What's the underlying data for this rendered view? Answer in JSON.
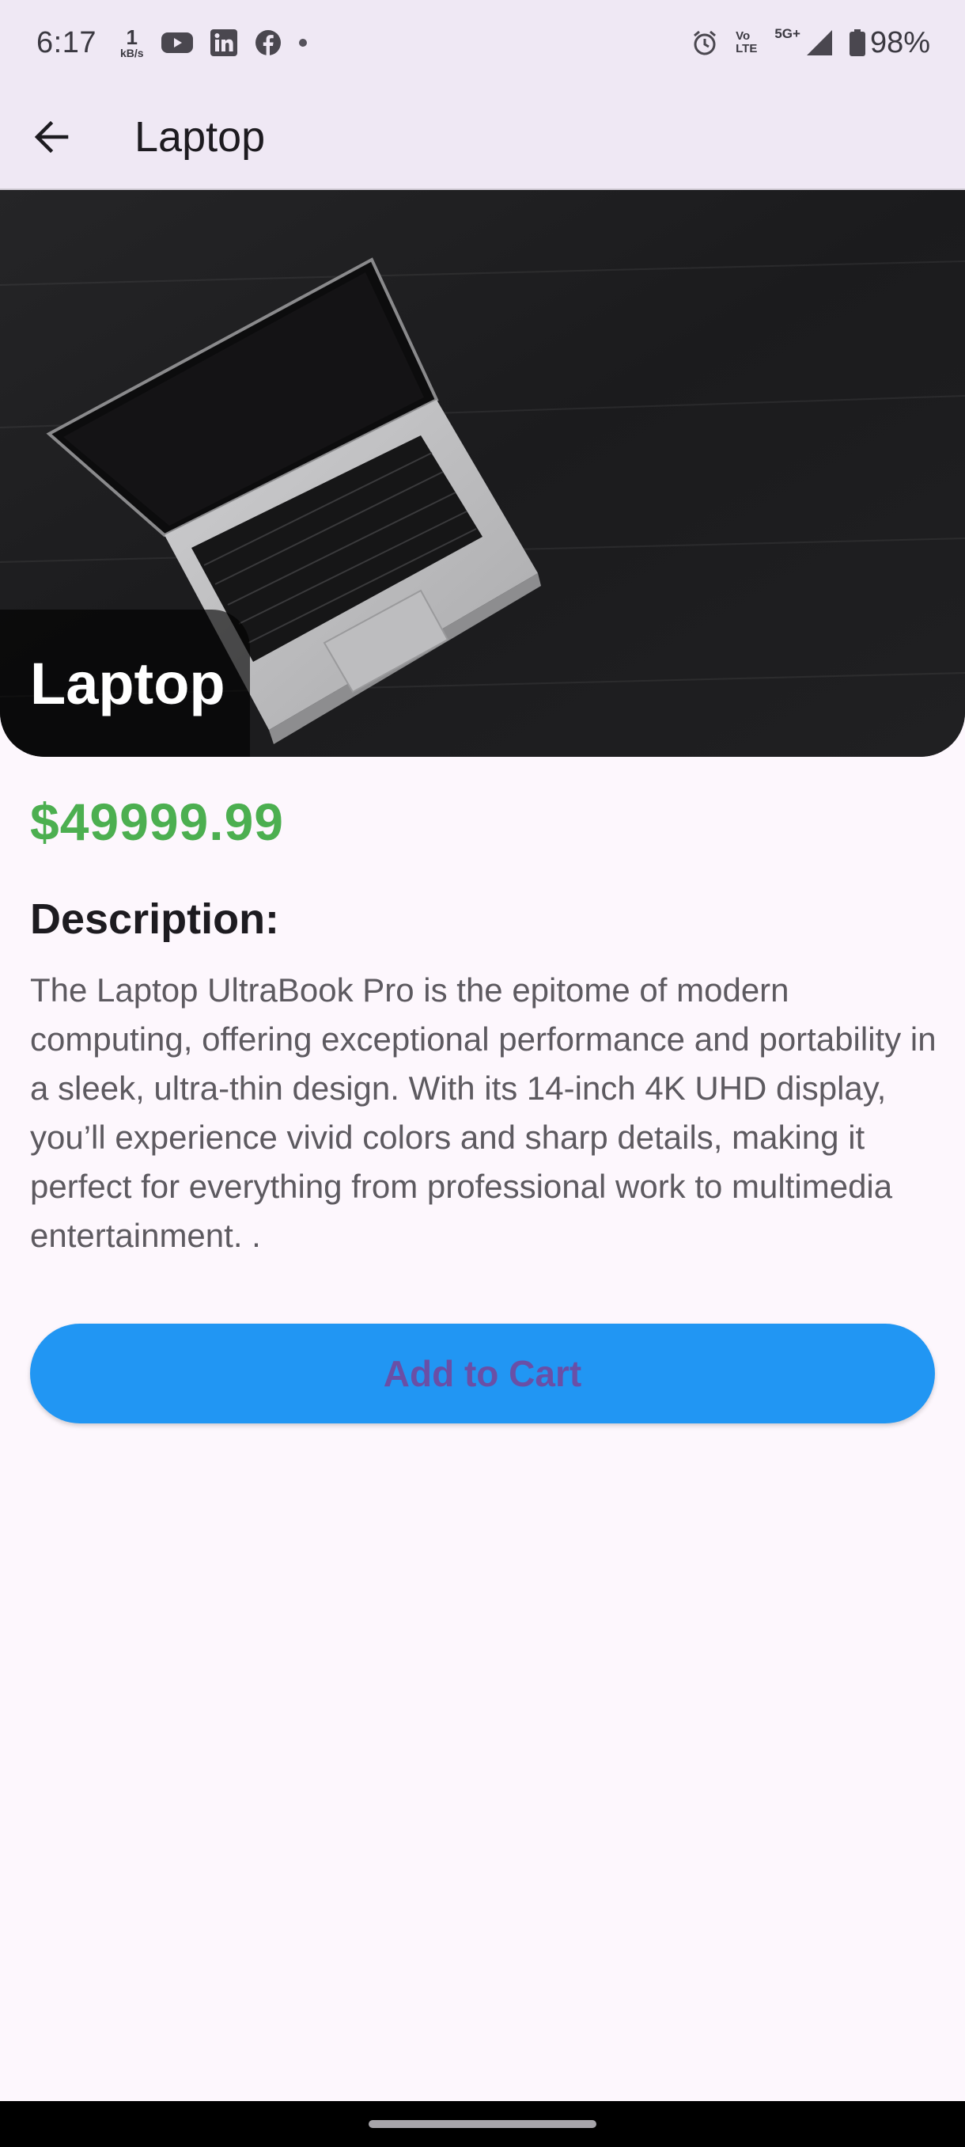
{
  "status_bar": {
    "time": "6:17",
    "net_speed_value": "1",
    "net_speed_unit": "kB/s",
    "volte_top": "Vo",
    "volte_bottom": "LTE",
    "network": "5G+",
    "battery": "98%",
    "icons": [
      "youtube-icon",
      "linkedin-icon",
      "facebook-icon",
      "alarm-icon",
      "signal-icon",
      "battery-icon"
    ]
  },
  "app_bar": {
    "title": "Laptop"
  },
  "product": {
    "image_label": "Laptop",
    "price": "$49999.99",
    "description_heading": "Description:",
    "description": "The Laptop UltraBook Pro is the epitome of modern computing, offering exceptional performance and portability in a sleek, ultra-thin design. With its 14-inch 4K UHD display, you’ll experience vivid colors and sharp details, making it perfect for everything from professional work to multimedia entertainment. ."
  },
  "actions": {
    "add_to_cart": "Add to Cart"
  },
  "colors": {
    "price": "#4caf50",
    "button_bg": "#2196f3",
    "button_text": "#6a4fa6",
    "app_bar_bg": "#efe8f4",
    "page_bg": "#fdf7fd"
  }
}
